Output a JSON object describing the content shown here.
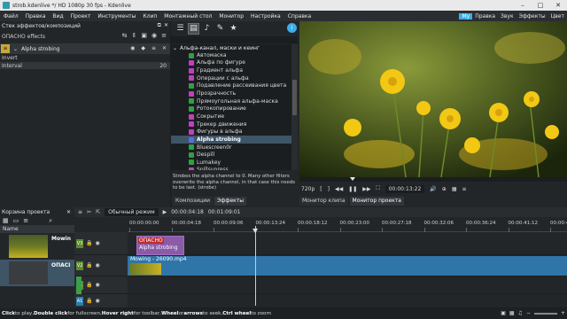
{
  "window": {
    "title": "strob.kdenlive */ HD 1080p 30 fps - Kdenlive"
  },
  "menu": [
    "Файл",
    "Правка",
    "Вид",
    "Проект",
    "Инструменты",
    "Клип",
    "Монтажный стол",
    "Монитор",
    "Настройка",
    "Справка"
  ],
  "workspaces": [
    "Мy",
    "Правка",
    "Звук",
    "Эффекты",
    "Цвет"
  ],
  "effect_stack": {
    "title": "Стек эффектов/композиций",
    "target": "ОПАСНО effects",
    "effect_name": "Alpha strobing",
    "params": [
      {
        "label": "Invert",
        "value": ""
      },
      {
        "label": "Interval",
        "value": "20"
      }
    ]
  },
  "effects_list": {
    "category": "Альфа-канал, маски и кеинг",
    "items": [
      {
        "label": "Автомаска",
        "color": "#2ea043"
      },
      {
        "label": "Альфа по фигуре",
        "color": "#c23fc2"
      },
      {
        "label": "Градиент альфа",
        "color": "#c23fc2"
      },
      {
        "label": "Операции с альфа",
        "color": "#c23fc2"
      },
      {
        "label": "Подавление рассеивания цвета",
        "color": "#2ea043"
      },
      {
        "label": "Прозрачность",
        "color": "#c23fc2"
      },
      {
        "label": "Прямоугольная альфа-маска",
        "color": "#2ea043"
      },
      {
        "label": "Ротокопирование",
        "color": "#2ea043"
      },
      {
        "label": "Сокрытие",
        "color": "#c23fc2"
      },
      {
        "label": "Трекер движения",
        "color": "#c23fc2"
      },
      {
        "label": "Фигуры в альфа",
        "color": "#c23fc2"
      },
      {
        "label": "Alpha strobing",
        "color": "#5a6fd8",
        "selected": true
      },
      {
        "label": "Bluescreen0r",
        "color": "#2ea043"
      },
      {
        "label": "Despill",
        "color": "#2ea043"
      },
      {
        "label": "Lumakey",
        "color": "#2ea043"
      },
      {
        "label": "Spillsupress",
        "color": "#c23fc2"
      }
    ],
    "description": "Strobes the alpha channel to 0. Many other filters overwrite the alpha channel, in that case this needs to be last. (strobe)"
  },
  "mid_tabs": [
    "Композиции",
    "Эффекты"
  ],
  "monitor": {
    "zoom": "720p",
    "timecode": "00:00:13:22",
    "tabs": [
      "Монитор клипа",
      "Монитор проекта"
    ]
  },
  "bin": {
    "title": "Корзина проекта",
    "column": "Name",
    "clips": [
      "Mowin",
      "ОПАСІ"
    ]
  },
  "timeline": {
    "mode": "Обычный режим",
    "position": "00:00:04:18",
    "duration": "00:01:09:01",
    "ruler": [
      "00:00:00:00",
      "00:00:04:18",
      "00:00:09:06",
      "00:00:13:24",
      "00:00:18:12",
      "00:00:23:00",
      "00:00:27:18",
      "00:00:32:06",
      "00:00:36:24",
      "00:00:41:12",
      "00:00:46:00"
    ],
    "tracks": [
      "V3",
      "V2",
      "V1",
      "A1",
      "A2"
    ],
    "clip_fx_label1": "ОПАСНО",
    "clip_fx_label2": "Alpha strobing",
    "clip_video": "Mowing - 26090.mp4"
  },
  "status": {
    "text_bold1": "Click",
    "text1": " to play, ",
    "text_bold2": "Double click",
    "text2": " for fullscreen, ",
    "text_bold3": "Hover right",
    "text3": " for toolbar, ",
    "text_bold4": "Wheel",
    "text4": " or ",
    "text_bold5": "arrows",
    "text5": " to seek, ",
    "text_bold6": "Ctrl wheel",
    "text6": " to zoom"
  }
}
